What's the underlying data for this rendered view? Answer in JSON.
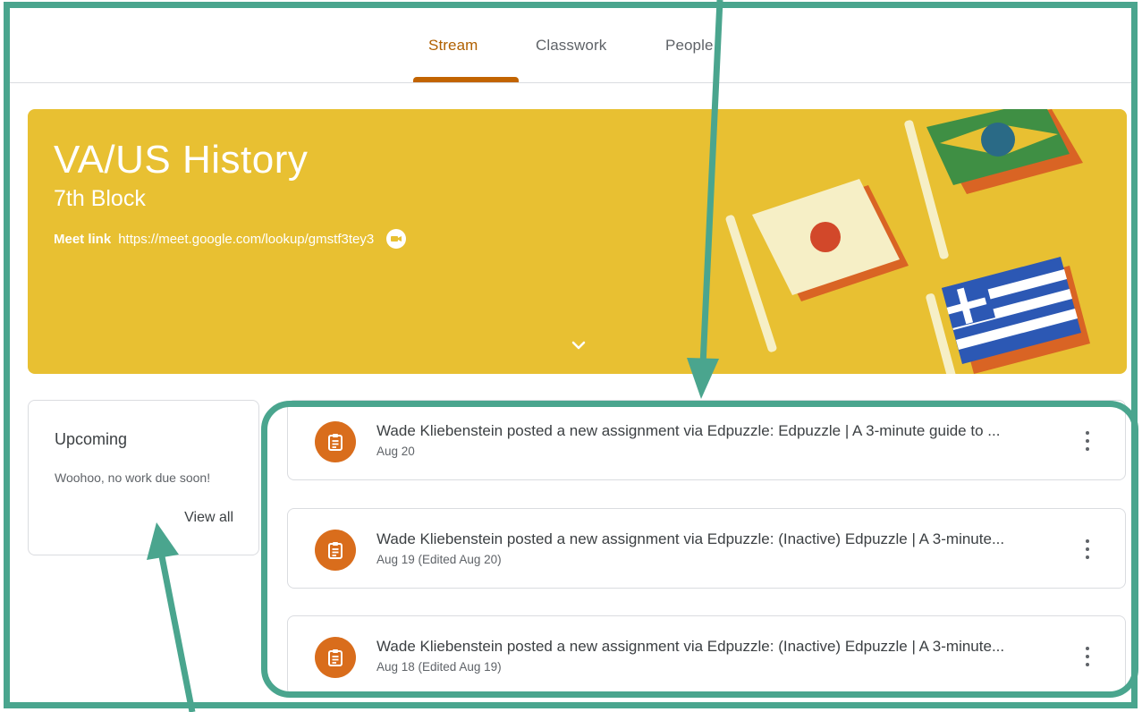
{
  "tabs": [
    {
      "label": "Stream",
      "active": true
    },
    {
      "label": "Classwork",
      "active": false
    },
    {
      "label": "People",
      "active": false
    }
  ],
  "banner": {
    "title": "VA/US History",
    "section": "7th Block",
    "meet_label": "Meet link",
    "meet_url": "https://meet.google.com/lookup/gmstf3tey3",
    "color": "#e8c032"
  },
  "upcoming": {
    "title": "Upcoming",
    "empty_message": "Woohoo, no work due soon!",
    "view_all_label": "View all"
  },
  "posts": [
    {
      "text": "Wade Kliebenstein posted a new assignment via Edpuzzle: Edpuzzle | A 3-minute guide to ...",
      "date": "Aug 20",
      "icon": "assignment-icon"
    },
    {
      "text": "Wade Kliebenstein posted a new assignment via Edpuzzle: (Inactive) Edpuzzle | A 3-minute...",
      "date": "Aug 19 (Edited Aug 20)",
      "icon": "assignment-icon"
    },
    {
      "text": "Wade Kliebenstein posted a new assignment via Edpuzzle: (Inactive) Edpuzzle | A 3-minute...",
      "date": "Aug 18 (Edited Aug 19)",
      "icon": "assignment-icon"
    }
  ],
  "colors": {
    "accent_tab": "#b06000",
    "annotation": "#4aa58e",
    "post_icon": "#d96d1c"
  }
}
